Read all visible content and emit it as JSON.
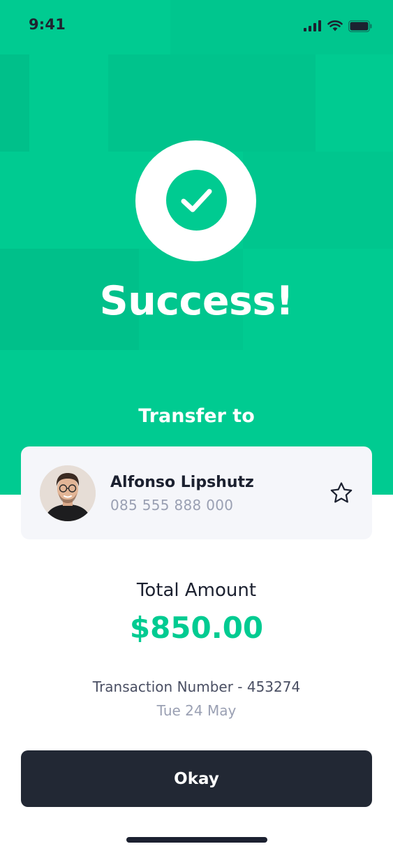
{
  "status_bar": {
    "time": "9:41",
    "icons": [
      "signal-icon",
      "wifi-icon",
      "battery-icon"
    ]
  },
  "colors": {
    "brand_green": "#00CB91",
    "dark": "#222834",
    "card_bg": "#F5F6FA"
  },
  "hero": {
    "icon": "check-icon",
    "title": "Success!",
    "transfer_label": "Transfer to"
  },
  "recipient": {
    "name": "Alfonso Lipshutz",
    "phone": "085 555 888 000",
    "avatar": "avatar",
    "favorite_icon": "star-icon"
  },
  "summary": {
    "total_label": "Total Amount",
    "total_amount": "$850.00",
    "transaction": "Transaction Number - 453274",
    "date": "Tue 24 May"
  },
  "actions": {
    "okay_label": "Okay"
  }
}
